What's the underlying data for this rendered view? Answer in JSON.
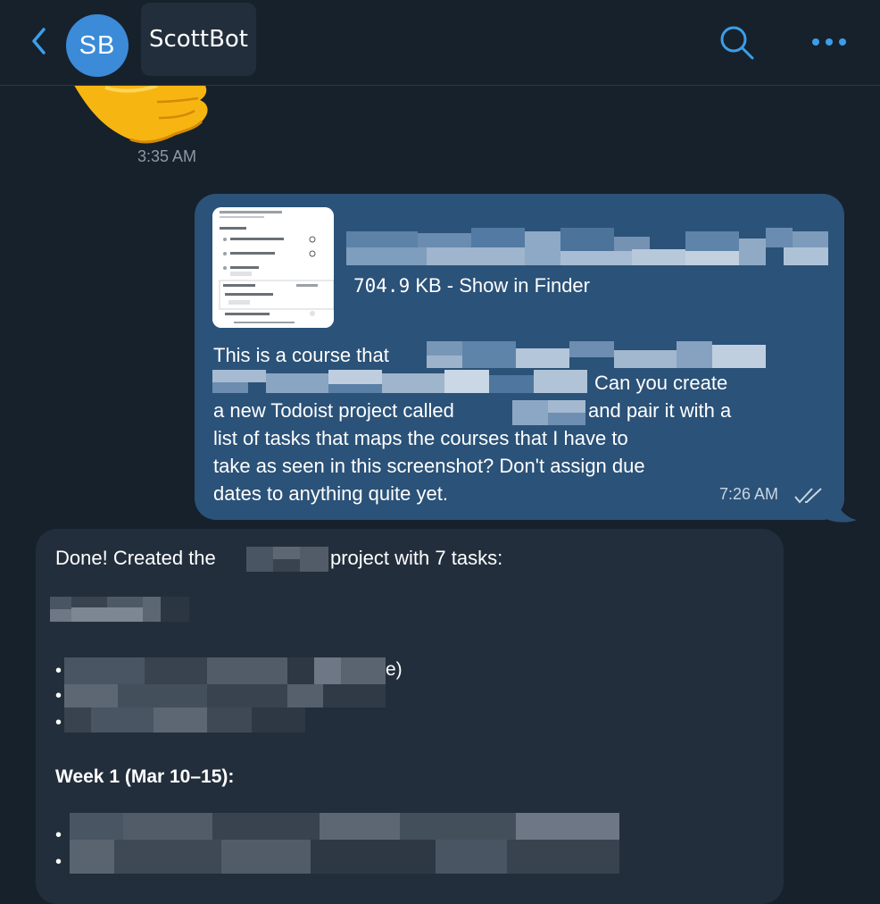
{
  "header": {
    "avatar_initials": "SB",
    "title": "ScottBot",
    "back_icon": "chevron-left-icon",
    "search_icon": "search-icon",
    "more_icon": "more-dots-icon"
  },
  "messages": {
    "emoji_message": {
      "emoji": "thumbs-up",
      "time": "3:35 AM"
    },
    "outgoing": {
      "file_size": "704.9",
      "file_size_unit": "KB - ",
      "finder_link": "Show in Finder",
      "text_line1": "This is a course that",
      "text_line2_end": "Can you create",
      "text_line3_start": "a new Todoist project called",
      "text_line3_end": "and pair it with a",
      "text_line4": "list of tasks that maps the courses that I have to",
      "text_line5": "take as seen in this screenshot? Don't assign due",
      "text_line6": "dates to anything quite yet.",
      "time": "7:26 AM",
      "status_icon": "double-check-icon"
    },
    "incoming": {
      "line1_start": "Done! Created the",
      "line1_end": "project with 7 tasks:",
      "bullet_char": "•",
      "bullet1_tail": "e)",
      "week_heading": "Week 1 (Mar 10–15):"
    }
  },
  "colors": {
    "background": "#17212b",
    "outgoing_bubble": "#2b5278",
    "incoming_bubble": "#232e3c",
    "accent": "#3b8bd9"
  }
}
